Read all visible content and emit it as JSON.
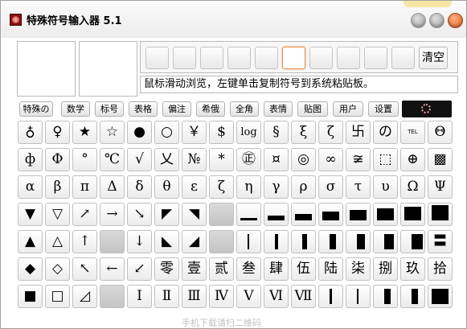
{
  "window": {
    "title": "特殊符号输入器 5.1"
  },
  "toolbar": {
    "clear_label": "清空",
    "active_slot": 5,
    "slot_count": 10
  },
  "hint": "鼠标滑动浏览，左键单击复制符号到系统粘贴板。",
  "tabs": [
    "特殊の",
    "数学",
    "标号",
    "表格",
    "偏注",
    "希俄",
    "全角",
    "表情",
    "贴图",
    "用户",
    "设置"
  ],
  "grid": {
    "rows": [
      [
        "♁",
        "♀",
        "★",
        "☆",
        "●",
        "○",
        "￥",
        "$",
        "log",
        "§",
        "ξ",
        "ζ",
        "卐",
        "の",
        "TEL",
        "Θ"
      ],
      [
        "ф",
        "Φ",
        "°",
        "℃",
        "√",
        "乂",
        "№",
        "*",
        "㊣",
        "¤",
        "◎",
        "∞",
        "≆",
        "⬚",
        "⊕",
        "▩"
      ],
      [
        "α",
        "β",
        "π",
        "Δ",
        "δ",
        "θ",
        "ε",
        "ζ",
        "η",
        "γ",
        "ρ",
        "σ",
        "τ",
        "υ",
        "Ω",
        "Ψ"
      ],
      [
        "▼",
        "▽",
        "↗",
        "→",
        "↘",
        "◤",
        "◥",
        "",
        "▁",
        "▂",
        "▃",
        "▄",
        "▅",
        "▆",
        "▇",
        "█"
      ],
      [
        "▲",
        "△",
        "↑",
        "",
        "↓",
        "◣",
        "◢",
        "",
        "▏",
        "▎",
        "▍",
        "▌",
        "▋",
        "▊",
        "▉",
        "〓"
      ],
      [
        "◆",
        "◇",
        "↖",
        "←",
        "↙",
        "零",
        "壹",
        "贰",
        "叁",
        "肆",
        "伍",
        "陆",
        "柒",
        "捌",
        "玖",
        "拾"
      ],
      [
        "■",
        "□",
        "◿",
        "",
        "Ⅰ",
        "Ⅱ",
        "Ⅲ",
        "Ⅳ",
        "Ⅴ",
        "Ⅵ",
        "Ⅶ",
        "▕",
        "▏",
        "▐",
        "▌",
        "█"
      ]
    ]
  },
  "watermark": "手机下载请扫二维码"
}
